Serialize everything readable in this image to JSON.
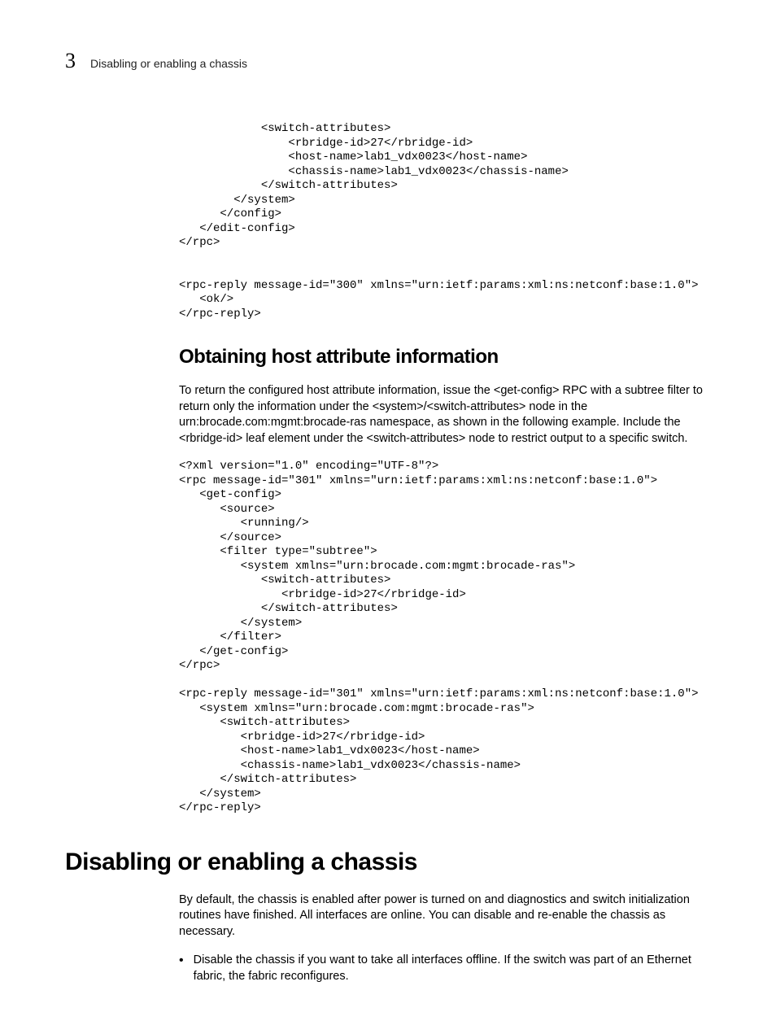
{
  "header": {
    "chapter_number": "3",
    "running_title": "Disabling or enabling a chassis"
  },
  "code1": "            <switch-attributes>\n                <rbridge-id>27</rbridge-id>\n                <host-name>lab1_vdx0023</host-name>\n                <chassis-name>lab1_vdx0023</chassis-name>\n            </switch-attributes>\n        </system>\n      </config>\n   </edit-config>\n</rpc>\n\n\n<rpc-reply message-id=\"300\" xmlns=\"urn:ietf:params:xml:ns:netconf:base:1.0\">\n   <ok/>\n</rpc-reply>",
  "heading1": "Obtaining host attribute information",
  "para1": "To return the configured host attribute information, issue the <get-config> RPC with a subtree filter to return only the information under the <system>/<switch-attributes> node in the urn:brocade.com:mgmt:brocade-ras namespace, as shown in the following example. Include the <rbridge-id> leaf element under the <switch-attributes> node to restrict output to a specific switch.",
  "code2": "<?xml version=\"1.0\" encoding=\"UTF-8\"?>\n<rpc message-id=\"301\" xmlns=\"urn:ietf:params:xml:ns:netconf:base:1.0\">\n   <get-config>\n      <source>\n         <running/>\n      </source>\n      <filter type=\"subtree\">\n         <system xmlns=\"urn:brocade.com:mgmt:brocade-ras\">\n            <switch-attributes>\n               <rbridge-id>27</rbridge-id>\n            </switch-attributes>\n         </system>\n      </filter>\n   </get-config>\n</rpc>\n\n<rpc-reply message-id=\"301\" xmlns=\"urn:ietf:params:xml:ns:netconf:base:1.0\">\n   <system xmlns=\"urn:brocade.com:mgmt:brocade-ras\">\n      <switch-attributes>\n         <rbridge-id>27</rbridge-id>\n         <host-name>lab1_vdx0023</host-name>\n         <chassis-name>lab1_vdx0023</chassis-name>\n      </switch-attributes>\n   </system>\n</rpc-reply>",
  "heading_main": "Disabling or enabling a chassis",
  "para2": "By default, the chassis is enabled after power is turned on and diagnostics and switch initialization routines have finished. All interfaces are online. You can disable and re-enable the chassis as necessary.",
  "bullet_dot": "•",
  "bullet1": "Disable the chassis if you want to take all interfaces offline. If the switch was part of an Ethernet fabric, the fabric reconfigures."
}
